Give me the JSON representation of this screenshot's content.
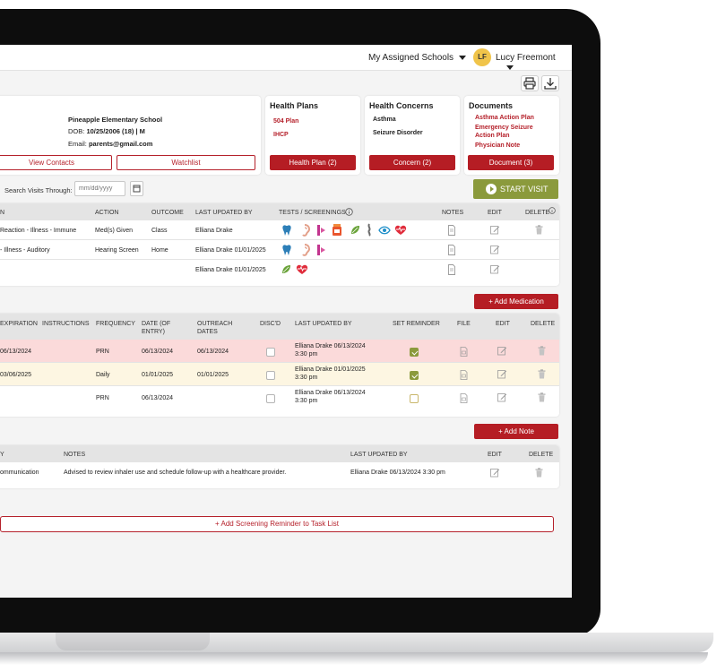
{
  "header": {
    "schools_label": "My Assigned Schools",
    "avatar_initials": "LF",
    "user_name": "Lucy Freemont"
  },
  "student": {
    "school": "Pineapple Elementary School",
    "dob_label": "DOB:",
    "dob_value": "10/25/2006 (18) | M",
    "email_label": "Email:",
    "email_value": "parents@gmail.com",
    "view_contacts": "View Contacts",
    "watchlist": "Watchlist"
  },
  "health_plans": {
    "title": "Health Plans",
    "items": [
      "504 Plan",
      "IHCP"
    ],
    "button": "Health Plan (2)"
  },
  "health_concerns": {
    "title": "Health Concerns",
    "items": [
      "Asthma",
      "Seizure Disorder"
    ],
    "button": "Concern (2)"
  },
  "documents": {
    "title": "Documents",
    "items": [
      "Asthma Action Plan",
      "Emergency Seizure Action Plan",
      "Physician Note"
    ],
    "button": "Document (3)"
  },
  "visits": {
    "search_label": "Search Visits Through:",
    "date_placeholder": "mm/dd/yyyy",
    "start_visit": "START VISIT",
    "headers": [
      "N",
      "ACTION",
      "OUTCOME",
      "LAST UPDATED BY",
      "TESTS / SCREENINGS",
      "NOTES",
      "EDIT",
      "DELETE"
    ],
    "rows": [
      {
        "reason": "Reaction - Illness - Immune",
        "action": "Med(s) Given",
        "outcome": "Class",
        "updated": "Elliana Drake"
      },
      {
        "reason": "- Illness - Auditory",
        "action": "Hearing Screen",
        "outcome": "Home",
        "updated": "Elliana Drake 01/01/2025"
      },
      {
        "reason": "",
        "action": "",
        "outcome": "",
        "updated": "Elliana Drake 01/01/2025"
      }
    ]
  },
  "medications": {
    "add_button": "+ Add Medication",
    "headers": {
      "expiration": "EXPIRATION",
      "instructions": "INSTRUCTIONS",
      "frequency": "FREQUENCY",
      "date_of_entry": "DATE (OF ENTRY)",
      "outreach_dates": "OUTREACH DATES",
      "discd": "DISC'D",
      "last_updated": "LAST UPDATED BY",
      "set_reminder": "SET REMINDER",
      "file": "FILE",
      "edit": "EDIT",
      "delete": "DELETE"
    },
    "rows": [
      {
        "expiration": "06/13/2024",
        "frequency": "PRN",
        "entry": "06/13/2024",
        "outreach": "06/13/2024",
        "updated": "Elliana Drake 06/13/2024 3:30 pm",
        "reminder": true
      },
      {
        "expiration": "03/06/2025",
        "frequency": "Daily",
        "entry": "01/01/2025",
        "outreach": "01/01/2025",
        "updated": "Elliana Drake 01/01/2025 3:30 pm",
        "reminder": true
      },
      {
        "expiration": "",
        "frequency": "PRN",
        "entry": "06/13/2024",
        "outreach": "",
        "updated": "Elliana Drake 06/13/2024 3:30 pm",
        "reminder": false
      }
    ]
  },
  "notes": {
    "add_button": "+ Add Note",
    "headers": {
      "category": "Y",
      "notes": "NOTES",
      "last_updated": "LAST UPDATED BY",
      "edit": "EDIT",
      "delete": "DELETE"
    },
    "rows": [
      {
        "category": "ommunication",
        "note": "Advised to review inhaler use and schedule follow-up with a healthcare provider.",
        "updated": "Elliana Drake 06/13/2024 3:30 pm"
      }
    ]
  },
  "screening": {
    "add_reminder": "+ Add Screening Reminder to Task List"
  },
  "colors": {
    "brand_red": "#b51d24",
    "accent_green": "#8b9a3c",
    "alert_row": "#fbdada",
    "warning_row": "#fdf6e2"
  }
}
